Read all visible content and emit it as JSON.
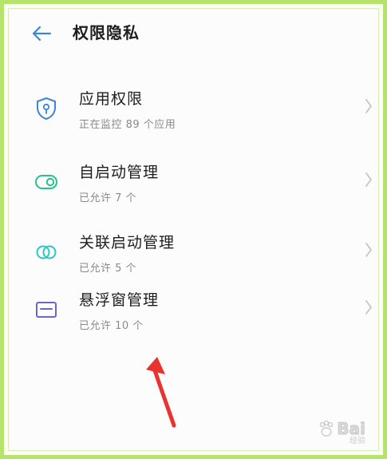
{
  "header": {
    "title": "权限隐私",
    "back_icon": "arrow-left-icon"
  },
  "items": [
    {
      "title": "应用权限",
      "subtitle": "正在监控 89 个应用",
      "icon": "shield-location-icon",
      "color": "#3b86d6"
    },
    {
      "title": "自启动管理",
      "subtitle": "已允许 7 个",
      "icon": "toggle-icon",
      "color": "#29c08a"
    },
    {
      "title": "关联启动管理",
      "subtitle": "已允许 5 个",
      "icon": "link-rings-icon",
      "color": "#2ec6c0"
    },
    {
      "title": "悬浮窗管理",
      "subtitle": "已允许 10 个",
      "icon": "floating-window-icon",
      "color": "#6b67c9"
    }
  ],
  "watermark": {
    "text": "Bai",
    "suffix": "经验"
  },
  "colors": {
    "frame_border": "#b6e46a",
    "annotation_arrow": "#e8332f",
    "title_text": "#1d1d1d",
    "subtitle_text": "#8a8a8a",
    "chevron": "#c4c4c4"
  }
}
